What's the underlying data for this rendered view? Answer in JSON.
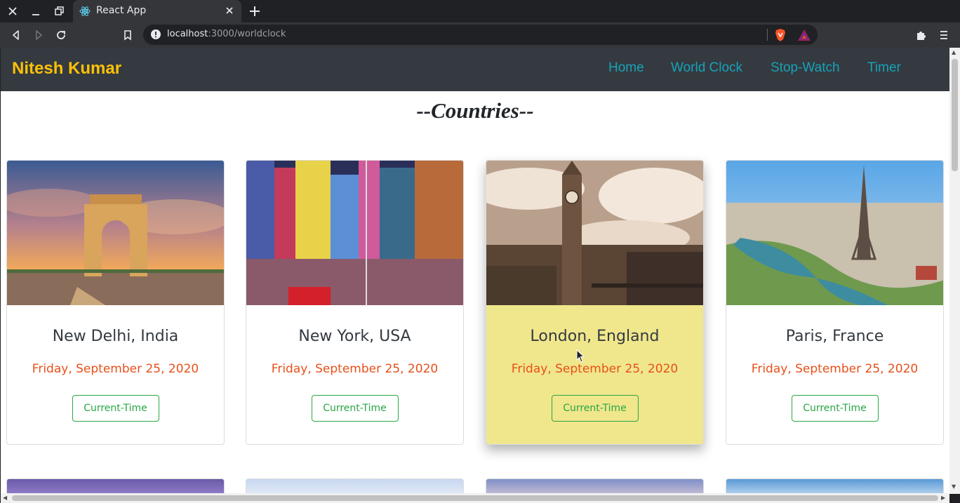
{
  "browser": {
    "tab_title": "React App",
    "url_host": "localhost",
    "url_rest": ":3000/worldclock"
  },
  "navbar": {
    "brand": "Nitesh Kumar",
    "links": [
      "Home",
      "World Clock",
      "Stop-Watch",
      "Timer"
    ]
  },
  "heading": "--Countries--",
  "cards": [
    {
      "title": "New Delhi, India",
      "date": "Friday, September 25, 2020",
      "button": "Current-Time",
      "image": "india-gate-photo"
    },
    {
      "title": "New York, USA",
      "date": "Friday, September 25, 2020",
      "button": "Current-Time",
      "image": "times-square-photo"
    },
    {
      "title": "London, England",
      "date": "Friday, September 25, 2020",
      "button": "Current-Time",
      "image": "big-ben-photo",
      "hovered": true
    },
    {
      "title": "Paris, France",
      "date": "Friday, September 25, 2020",
      "button": "Current-Time",
      "image": "eiffel-tower-photo"
    }
  ],
  "colors": {
    "brand": "#ffc107",
    "nav_link": "#17a2b8",
    "navbar_bg": "#343a40",
    "date": "#e8501a",
    "button": "#28a745",
    "hover_card": "#f0e68c"
  }
}
